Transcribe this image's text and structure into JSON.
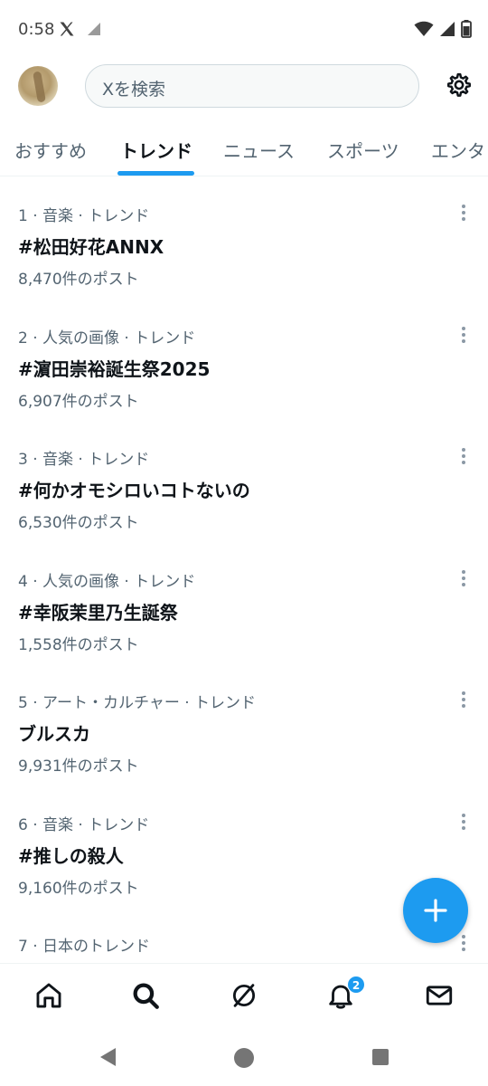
{
  "status_bar": {
    "time": "0:58"
  },
  "header": {
    "search_placeholder": "Xを検索"
  },
  "tabs": [
    {
      "label": "おすすめ"
    },
    {
      "label": "トレンド"
    },
    {
      "label": "ニュース"
    },
    {
      "label": "スポーツ"
    },
    {
      "label": "エンタ"
    }
  ],
  "trends": [
    {
      "meta": "1 · 音楽 · トレンド",
      "title": "#松田好花ANNX",
      "count": "8,470件のポスト"
    },
    {
      "meta": "2 · 人気の画像 · トレンド",
      "title": "#濵田崇裕誕生祭2025",
      "count": "6,907件のポスト"
    },
    {
      "meta": "3 · 音楽 · トレンド",
      "title": "#何かオモシロいコトないの",
      "count": "6,530件のポスト"
    },
    {
      "meta": "4 · 人気の画像 · トレンド",
      "title": "#幸阪茉里乃生誕祭",
      "count": "1,558件のポスト"
    },
    {
      "meta": "5 · アート・カルチャー · トレンド",
      "title": "ブルスカ",
      "count": "9,931件のポスト"
    },
    {
      "meta": "6 · 音楽 · トレンド",
      "title": "#推しの殺人",
      "count": "9,160件のポスト"
    },
    {
      "meta": "7 · 日本のトレンド",
      "title": "",
      "count": ""
    }
  ],
  "bottom_nav": {
    "notifications_badge": "2"
  },
  "colors": {
    "accent": "#1d9bf0",
    "text": "#0f1419",
    "secondary": "#536471"
  }
}
